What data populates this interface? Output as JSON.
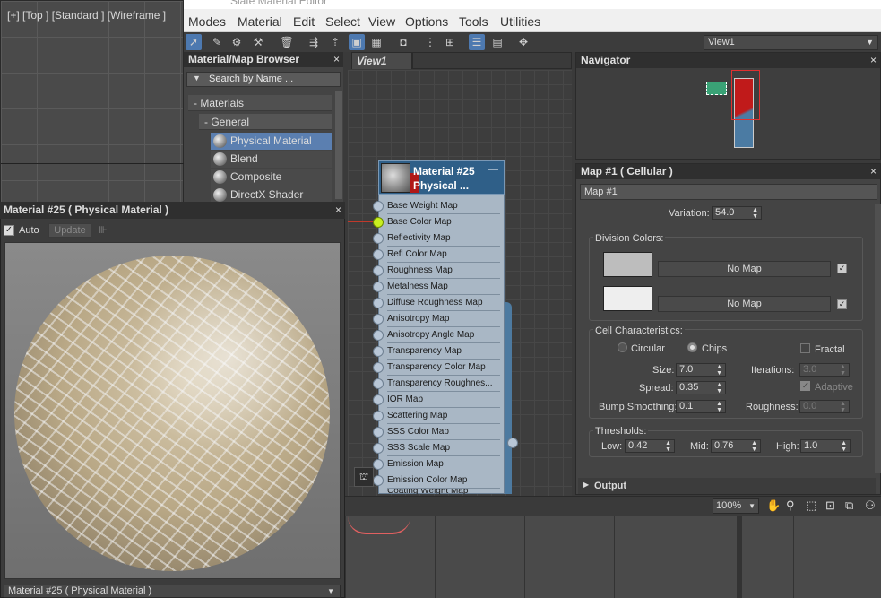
{
  "viewport": {
    "label": "[+] [Top ] [Standard ] [Wireframe ]"
  },
  "window": {
    "title": "Slate Material Editor"
  },
  "menu": [
    "Modes",
    "Material",
    "Edit",
    "Select",
    "View",
    "Options",
    "Tools",
    "Utilities"
  ],
  "toolbar": {
    "view_select": "View1"
  },
  "browser": {
    "title": "Material/Map Browser",
    "search_placeholder": "Search by Name ...",
    "section": "- Materials",
    "subsection": "- General",
    "items": [
      "Physical Material",
      "Blend",
      "Composite",
      "DirectX Shader"
    ],
    "selected": "Physical Material"
  },
  "view_tab": "View1",
  "node": {
    "title_line1": "Material #25",
    "title_line2": "Physical ...",
    "slots": [
      "Base Weight Map",
      "Base Color Map",
      "Reflectivity Map",
      "Refl Color Map",
      "Roughness Map",
      "Metalness Map",
      "Diffuse Roughness Map",
      "Anisotropy Map",
      "Anisotropy Angle Map",
      "Transparency Map",
      "Transparency Color Map",
      "Transparency Roughnes...",
      "IOR Map",
      "Scattering Map",
      "SSS Color Map",
      "SSS Scale Map",
      "Emission Map",
      "Emission Color Map",
      "Coating Weight Map"
    ],
    "active_slot": "Base Color Map"
  },
  "preview": {
    "title": "Material #25  ( Physical Material )",
    "auto_label": "Auto",
    "update_label": "Update",
    "select_value": "Material #25  ( Physical Material )"
  },
  "navigator": {
    "title": "Navigator"
  },
  "map_panel": {
    "title": "Map #1  ( Cellular )",
    "name": "Map #1",
    "variation_label": "Variation:",
    "variation": "54.0",
    "division_colors_label": "Division Colors:",
    "no_map": "No Map",
    "swatch_colors": [
      "#bdbdbd",
      "#eeeeee"
    ],
    "cell_label": "Cell Characteristics:",
    "circular": "Circular",
    "chips": "Chips",
    "fractal": "Fractal",
    "size_label": "Size:",
    "size": "7.0",
    "spread_label": "Spread:",
    "spread": "0.35",
    "bump_label": "Bump Smoothing:",
    "bump": "0.1",
    "iterations_label": "Iterations:",
    "iterations": "3.0",
    "adaptive": "Adaptive",
    "roughness_label": "Roughness:",
    "roughness": "0.0",
    "thresholds_label": "Thresholds:",
    "low_label": "Low:",
    "low": "0.42",
    "mid_label": "Mid:",
    "mid": "0.76",
    "high_label": "High:",
    "high": "1.0",
    "output_label": "Output"
  },
  "bottom": {
    "zoom": "100%"
  }
}
